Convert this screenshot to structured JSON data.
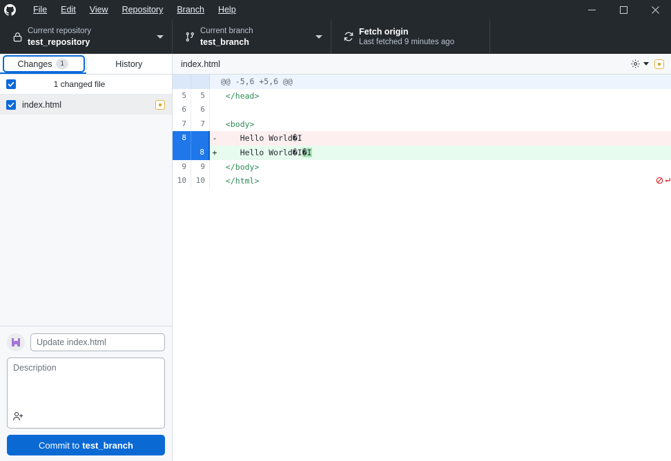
{
  "window": {
    "app_logo": "github-octocat-logo",
    "menu": [
      {
        "label": "File",
        "mnemonic": "F"
      },
      {
        "label": "Edit",
        "mnemonic": "E"
      },
      {
        "label": "View",
        "mnemonic": "V"
      },
      {
        "label": "Repository",
        "mnemonic": "R"
      },
      {
        "label": "Branch",
        "mnemonic": "B"
      },
      {
        "label": "Help",
        "mnemonic": "H"
      }
    ],
    "controls": {
      "minimize": "minimize-icon",
      "maximize": "maximize-icon",
      "close": "close-icon"
    }
  },
  "toolbar": {
    "repository": {
      "icon": "lock-icon",
      "label": "Current repository",
      "value": "test_repository",
      "caret": "chevron-down-icon"
    },
    "branch": {
      "icon": "branch-icon",
      "label": "Current branch",
      "value": "test_branch",
      "caret": "chevron-down-icon"
    },
    "fetch": {
      "icon": "sync-icon",
      "label": "Fetch origin",
      "value": "Last fetched 9 minutes ago"
    }
  },
  "sidebar": {
    "tabs": [
      {
        "label": "Changes",
        "badge": "1",
        "active": true
      },
      {
        "label": "History",
        "badge": "",
        "active": false
      }
    ],
    "files_header": {
      "checkbox_checked": true,
      "text": "1 changed file"
    },
    "files": [
      {
        "name": "index.html",
        "checked": true,
        "status": "modified",
        "status_icon": "modified-status-icon",
        "selected": true
      }
    ]
  },
  "commit": {
    "avatar": "user-avatar",
    "summary_placeholder": "Update index.html",
    "summary_value": "",
    "description_placeholder": "Description",
    "description_value": "",
    "coauthor_icon": "add-coauthor-icon",
    "button_prefix": "Commit to",
    "button_branch": "test_branch"
  },
  "diff": {
    "filename": "index.html",
    "settings_icon": "gear-icon",
    "settings_caret": "chevron-down-icon",
    "status_icon": "modified-status-icon",
    "hunk_header": "@@ -5,6 +5,6 @@",
    "lines": [
      {
        "type": "hunk",
        "old": "",
        "new": "",
        "marker": "",
        "text": "@@ -5,6 +5,6 @@"
      },
      {
        "type": "context",
        "old": "5",
        "new": "5",
        "marker": "",
        "text": " </head>"
      },
      {
        "type": "context",
        "old": "6",
        "new": "6",
        "marker": "",
        "text": ""
      },
      {
        "type": "context",
        "old": "7",
        "new": "7",
        "marker": "",
        "text": " <body>"
      },
      {
        "type": "delete",
        "old": "8",
        "new": "",
        "marker": "-",
        "text": "    Hello World�I"
      },
      {
        "type": "add",
        "old": "",
        "new": "8",
        "marker": "+",
        "text": "    Hello World�I�I",
        "inserted": "�I"
      },
      {
        "type": "context",
        "old": "9",
        "new": "9",
        "marker": "",
        "text": " </body>"
      },
      {
        "type": "context",
        "old": "10",
        "new": "10",
        "marker": "",
        "text": " </html>",
        "no_newline": true
      }
    ]
  },
  "colors": {
    "titlebar_bg": "#24292e",
    "accent_blue": "#0969da",
    "commit_button": "#0b69d4",
    "selection_blue": "#1f77ea",
    "add_bg": "#e7fbee",
    "add_word_hl": "#abe8bd",
    "delete_bg": "#fdeff0",
    "hunk_bg": "#eef4fd",
    "modified_yellow": "#e3b341",
    "no_newline_red": "#cf222e"
  }
}
